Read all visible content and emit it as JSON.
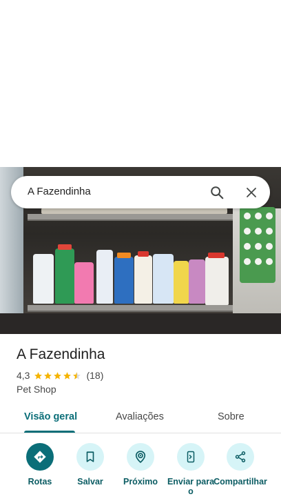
{
  "search": {
    "query": "A Fazendinha",
    "search_icon": "search-icon",
    "close_icon": "close-icon"
  },
  "place": {
    "name": "A Fazendinha",
    "rating": "4,3",
    "rating_value": 4.3,
    "reviews_count": "(18)",
    "category": "Pet Shop"
  },
  "tabs": [
    {
      "label": "Visão geral",
      "active": true
    },
    {
      "label": "Avaliações",
      "active": false
    },
    {
      "label": "Sobre",
      "active": false
    }
  ],
  "actions": [
    {
      "label": "Rotas",
      "icon": "directions-icon"
    },
    {
      "label": "Salvar",
      "icon": "bookmark-icon"
    },
    {
      "label": "Próximo",
      "icon": "nearby-icon"
    },
    {
      "label": "Enviar para o",
      "icon": "send-to-phone-icon"
    },
    {
      "label": "Compartilhar",
      "icon": "share-icon"
    }
  ],
  "colors": {
    "accent": "#0b6e78",
    "accent_light": "#d6f4f7",
    "star": "#f5b400"
  }
}
